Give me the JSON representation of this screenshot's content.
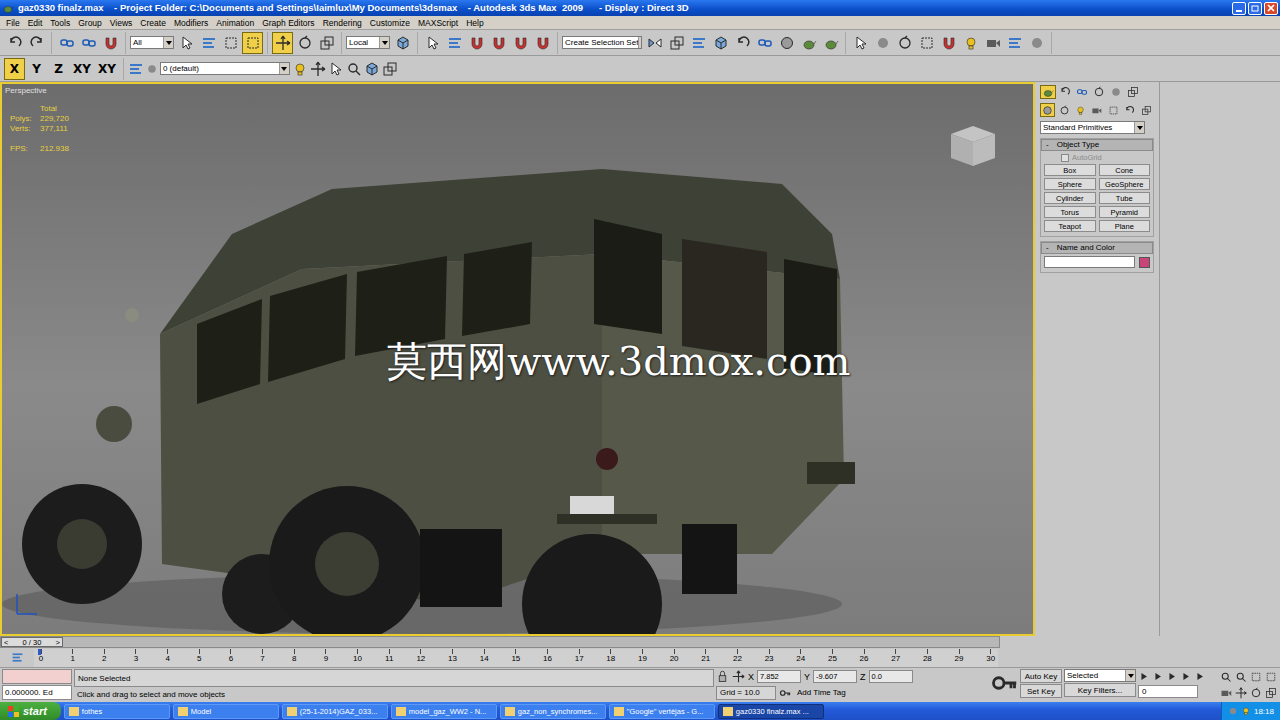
{
  "window": {
    "title": "gaz0330 finalz.max    - Project Folder: C:\\Documents and Settings\\Iaimlux\\My Documents\\3dsmax    - Autodesk 3ds Max  2009      - Display : Direct 3D"
  },
  "menu": [
    "File",
    "Edit",
    "Tools",
    "Group",
    "Views",
    "Create",
    "Modifiers",
    "Animation",
    "Graph Editors",
    "Rendering",
    "Customize",
    "MAXScript",
    "Help"
  ],
  "main_toolbar": {
    "selection_filter": "All",
    "coordinate_system": "Local",
    "selection_set": "Create Selection Set",
    "history": [
      {
        "selected": false
      },
      {
        "selected": false
      }
    ],
    "linking": [
      {
        "selected": false
      },
      {
        "selected": false
      },
      {
        "selected": false
      }
    ],
    "selection": [
      {
        "selected": false
      },
      {
        "selected": false
      },
      {
        "selected": false
      },
      {
        "selected": true
      }
    ],
    "transform": [
      {
        "selected": true
      },
      {
        "selected": false
      },
      {
        "selected": false
      }
    ],
    "pivot": [
      {
        "selected": false
      }
    ],
    "snaps": [
      {
        "selected": false
      },
      {
        "selected": false
      },
      {
        "selected": false
      },
      {
        "selected": false
      },
      {
        "selected": false
      },
      {
        "selected": false
      }
    ],
    "editors": [
      {
        "selected": false
      },
      {
        "selected": false
      },
      {
        "selected": false
      },
      {
        "selected": false
      },
      {
        "selected": false
      },
      {
        "selected": false
      },
      {
        "selected": false
      },
      {
        "selected": false
      },
      {
        "selected": false
      }
    ],
    "render": [
      {
        "selected": false
      },
      {
        "selected": false
      },
      {
        "selected": false
      },
      {
        "selected": false
      },
      {
        "selected": false
      },
      {
        "selected": false
      },
      {
        "selected": false
      },
      {
        "selected": false
      },
      {
        "selected": false
      }
    ]
  },
  "axis_toolbar": {
    "axes": [
      {
        "label": "X",
        "selected": true
      },
      {
        "label": "Y",
        "selected": false
      },
      {
        "label": "Z",
        "selected": false
      },
      {
        "label": "XY",
        "selected": false
      },
      {
        "label": "XY",
        "selected": false
      }
    ],
    "layer": "0 (default)"
  },
  "viewport": {
    "label": "Perspective",
    "active": true,
    "stats_header": "Total",
    "stats": [
      {
        "name": "Polys:",
        "value": "229,720"
      },
      {
        "name": "Verts:",
        "value": "377,111"
      }
    ],
    "fps": {
      "name": "FPS:",
      "value": "212.938"
    },
    "watermark": "莫西网www.3dmox.com"
  },
  "command_panel": {
    "tabs": [
      {
        "selected": true
      },
      {
        "selected": false
      },
      {
        "selected": false
      },
      {
        "selected": false
      },
      {
        "selected": false
      },
      {
        "selected": false
      }
    ],
    "categories": [
      {
        "selected": true
      },
      {
        "selected": false
      },
      {
        "selected": false
      },
      {
        "selected": false
      },
      {
        "selected": false
      },
      {
        "selected": false
      },
      {
        "selected": false
      }
    ],
    "category": "Standard Primitives",
    "object_type": {
      "collapse": "-",
      "title": "Object Type",
      "autogrid": {
        "label": "AutoGrid",
        "checked": false,
        "disabled": true
      },
      "buttons": [
        "Box",
        "Cone",
        "Sphere",
        "GeoSphere",
        "Cylinder",
        "Tube",
        "Torus",
        "Pyramid",
        "Teapot",
        "Plane"
      ]
    },
    "name_and_color": {
      "collapse": "-",
      "title": "Name and Color",
      "name": "",
      "color": "#c8457a"
    }
  },
  "time_slider": {
    "prev": "<",
    "position": "0 / 30",
    "next": ">",
    "level": 0
  },
  "track_bar": {
    "ticks": [
      "0",
      "1",
      "2",
      "3",
      "4",
      "5",
      "6",
      "7",
      "8",
      "9",
      "10",
      "11",
      "12",
      "13",
      "14",
      "15",
      "16",
      "17",
      "18",
      "19",
      "20",
      "21",
      "22",
      "23",
      "24",
      "25",
      "26",
      "27",
      "28",
      "29",
      "30"
    ],
    "level": 0
  },
  "status": {
    "listener": "0.000000. Ed",
    "selection": "None Selected",
    "prompt": "Click and drag to select and move objects",
    "coords": [
      {
        "axis": "X",
        "value": "7.852"
      },
      {
        "axis": "Y",
        "value": "-9.607"
      },
      {
        "axis": "Z",
        "value": "0.0"
      }
    ],
    "grid": "Grid = 10.0",
    "time_tag": "Add Time Tag"
  },
  "animation": {
    "auto_key": "Auto Key",
    "key_mode": "Selected",
    "set_key": "Set Key",
    "key_filters": "Key Filters...",
    "frame": "0"
  },
  "taskbar": {
    "start": "start",
    "items": [
      {
        "label": "fothes",
        "selected": false
      },
      {
        "label": "Model",
        "selected": false
      },
      {
        "label": "(25-1-2014)GAZ_033...",
        "selected": false
      },
      {
        "label": "model_gaz_WW2 - N...",
        "selected": false
      },
      {
        "label": "gaz_non_synchromes...",
        "selected": false
      },
      {
        "label": "\"Google\" vertėjas - G...",
        "selected": false
      },
      {
        "label": "gaz0330 finalz.max ...",
        "selected": true
      }
    ],
    "clock": "18:18"
  }
}
